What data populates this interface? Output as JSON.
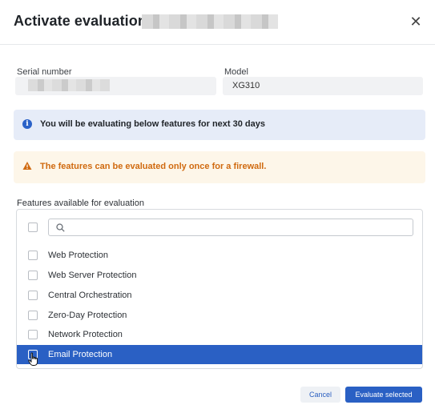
{
  "dialog": {
    "title": "Activate evaluations -",
    "close_icon": "close-icon"
  },
  "serial": {
    "label": "Serial number",
    "value": ""
  },
  "model": {
    "label": "Model",
    "value": "XG310"
  },
  "info": {
    "icon": "info-icon",
    "text": "You will be evaluating below features for next 30 days",
    "color": "#2b62c8"
  },
  "warning": {
    "icon": "warning-icon",
    "text": "The features can be evaluated only once for a firewall.",
    "color": "#d06a10"
  },
  "features": {
    "label": "Features available for evaluation",
    "search_placeholder": "",
    "items": [
      {
        "label": "Web Protection",
        "checked": false
      },
      {
        "label": "Web Server Protection",
        "checked": false
      },
      {
        "label": "Central Orchestration",
        "checked": false
      },
      {
        "label": "Zero-Day Protection",
        "checked": false
      },
      {
        "label": "Network Protection",
        "checked": false
      },
      {
        "label": "Email Protection",
        "checked": true
      }
    ]
  },
  "buttons": {
    "cancel": "Cancel",
    "evaluate": "Evaluate selected"
  },
  "colors": {
    "accent": "#2a60c4",
    "selected_row": "#2a60c4"
  }
}
